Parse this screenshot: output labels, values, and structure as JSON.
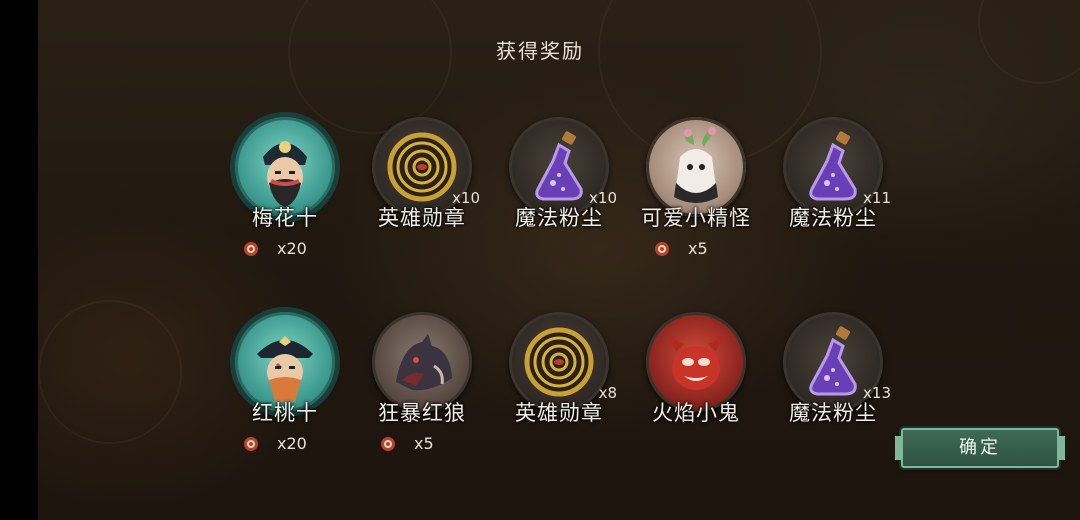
{
  "dialog": {
    "title": "获得奖励",
    "confirm_label": "确定"
  },
  "rewards": [
    {
      "name": "梅花十",
      "icon": "hero-portrait-icon",
      "badge": "",
      "fragment_count": "x20"
    },
    {
      "name": "英雄勋章",
      "icon": "hero-medal-icon",
      "badge": "x10",
      "fragment_count": ""
    },
    {
      "name": "魔法粉尘",
      "icon": "magic-dust-potion-icon",
      "badge": "x10",
      "fragment_count": ""
    },
    {
      "name": "可爱小精怪",
      "icon": "cute-sprite-portrait-icon",
      "badge": "",
      "fragment_count": "x5"
    },
    {
      "name": "魔法粉尘",
      "icon": "magic-dust-potion-icon",
      "badge": "x11",
      "fragment_count": ""
    },
    {
      "name": "红桃十",
      "icon": "hero-portrait-icon",
      "badge": "",
      "fragment_count": "x20"
    },
    {
      "name": "狂暴红狼",
      "icon": "red-wolf-portrait-icon",
      "badge": "",
      "fragment_count": "x5"
    },
    {
      "name": "英雄勋章",
      "icon": "hero-medal-icon",
      "badge": "x8",
      "fragment_count": ""
    },
    {
      "name": "火焰小鬼",
      "icon": "fire-imp-portrait-icon",
      "badge": "",
      "fragment_count": ""
    },
    {
      "name": "魔法粉尘",
      "icon": "magic-dust-potion-icon",
      "badge": "x13",
      "fragment_count": ""
    }
  ],
  "colors": {
    "confirm_button": "#3f6a55",
    "hero_badge": "#3e9b90",
    "fragment_coin": "#b3452e"
  }
}
